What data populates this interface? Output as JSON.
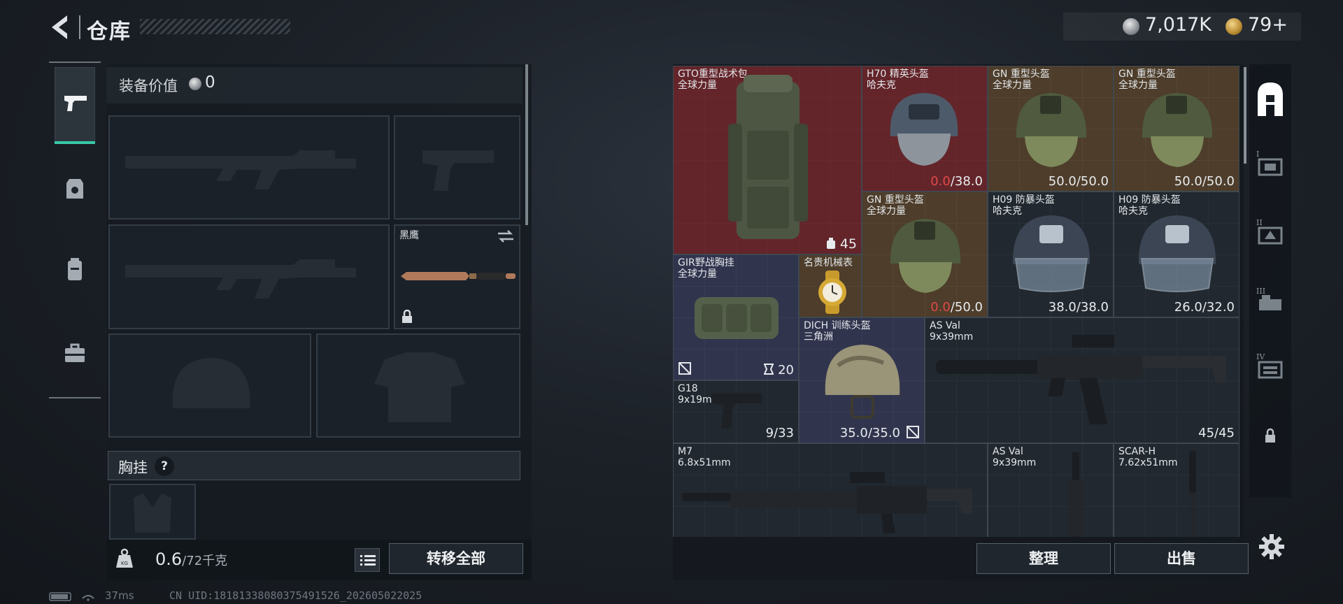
{
  "header": {
    "title": "仓库"
  },
  "currency": {
    "silver": "7,017K",
    "gold": "79+"
  },
  "loadout": {
    "equip_value_label": "装备价值",
    "equip_value": "0",
    "knife_name": "黑鹰",
    "chest_label": "胸挂",
    "chest_help": "?",
    "weight_value": "0.6",
    "weight_max": "/72千克",
    "transfer_all": "转移全部"
  },
  "status": {
    "ping": "37ms",
    "uid": "CN UID:18181338080375491526_202605022025"
  },
  "storage": {
    "items": [
      {
        "name": "GTO重型战术包",
        "sub": "全球力量",
        "badge": "45"
      },
      {
        "name": "H70 精英头盔",
        "sub": "哈夫克",
        "dur_bad": "0.0",
        "dur_rest": "/38.0"
      },
      {
        "name": "GN 重型头盔",
        "sub": "全球力量",
        "dur": "50.0/50.0"
      },
      {
        "name": "GN 重型头盔",
        "sub": "全球力量",
        "dur": "50.0/50.0"
      },
      {
        "name": "GN 重型头盔",
        "sub": "全球力量",
        "dur_bad": "0.0",
        "dur_rest": "/50.0"
      },
      {
        "name": "H09 防暴头盔",
        "sub": "哈夫克",
        "dur": "38.0/38.0"
      },
      {
        "name": "H09 防暴头盔",
        "sub": "哈夫克",
        "dur": "26.0/32.0"
      },
      {
        "name": "GIR野战胸挂",
        "sub": "全球力量",
        "badge": "20"
      },
      {
        "name": "名贵机械表"
      },
      {
        "name": "DICH 训练头盔",
        "sub": "三角洲",
        "dur": "35.0/35.0"
      },
      {
        "name": "AS Val",
        "sub": "9x39mm",
        "dur": "45/45"
      },
      {
        "name": "G18",
        "sub": "9x19mm",
        "dur": "9/33"
      },
      {
        "name": "M7",
        "sub": "6.8x51mm"
      },
      {
        "name": "AS Val",
        "sub": "9x39mm"
      },
      {
        "name": "SCAR-H",
        "sub": "7.62x51mm"
      }
    ],
    "sort_label": "整理",
    "sell_label": "出售"
  },
  "right_nav": [
    "I",
    "II",
    "III",
    "IV"
  ],
  "colors": {
    "accent": "#37c9a8",
    "danger": "#e04848",
    "rare_red": "#78262c",
    "rare_gold": "#785530",
    "rare_blue": "#46466e"
  }
}
